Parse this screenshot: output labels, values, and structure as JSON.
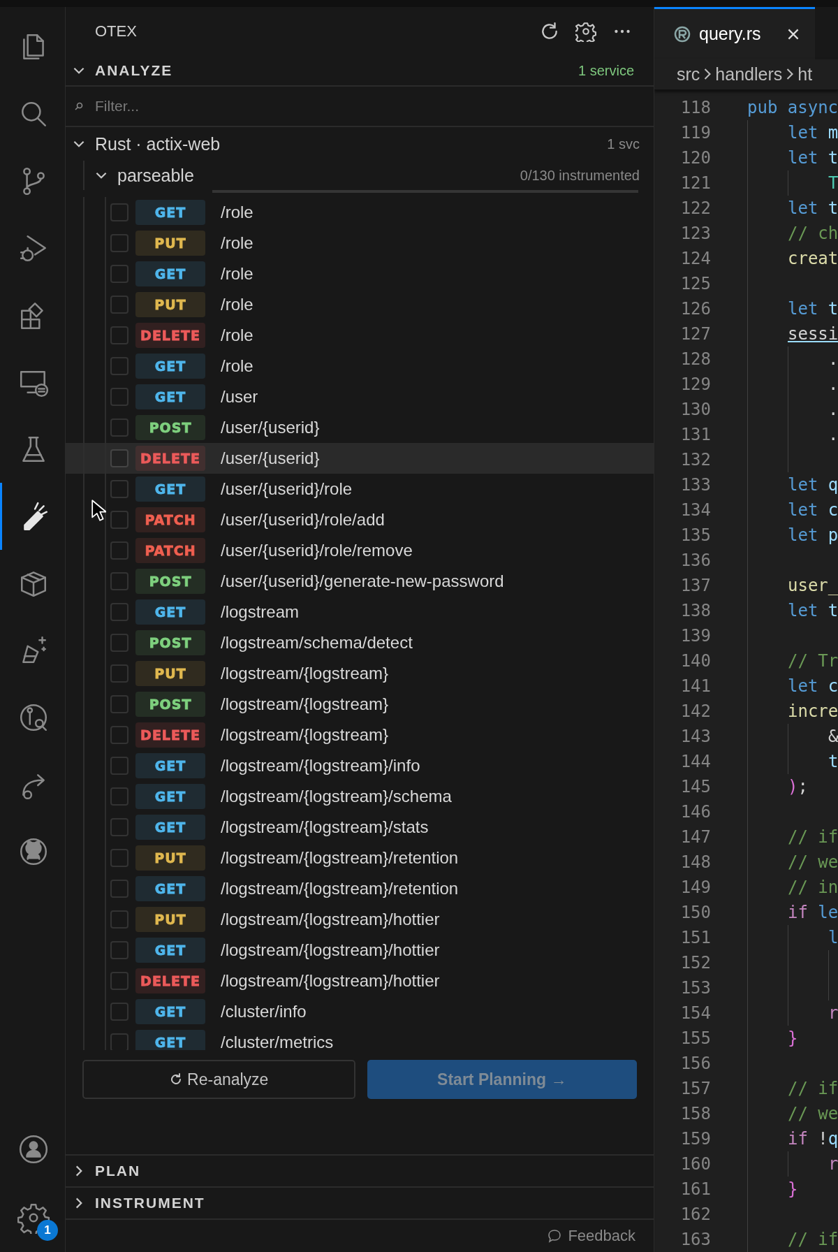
{
  "activity_bar": {
    "items": [
      {
        "kind": "files",
        "selected": false
      },
      {
        "kind": "search",
        "selected": false
      },
      {
        "kind": "branch",
        "selected": false
      },
      {
        "kind": "debug",
        "selected": false
      },
      {
        "kind": "extensions",
        "selected": false
      },
      {
        "kind": "remote",
        "selected": false
      },
      {
        "kind": "flask",
        "selected": false
      },
      {
        "kind": "probe",
        "selected": true
      },
      {
        "kind": "package",
        "selected": false
      },
      {
        "kind": "sparkle-flask",
        "selected": false
      },
      {
        "kind": "graph-search",
        "selected": false
      },
      {
        "kind": "share",
        "selected": false
      },
      {
        "kind": "cat",
        "selected": false
      }
    ],
    "account": {
      "kind": "account"
    },
    "settings": {
      "kind": "settings",
      "badge": "1"
    }
  },
  "sidebar": {
    "title": "OTEX",
    "sections": [
      {
        "title": "ANALYZE",
        "expanded": true,
        "badge": "1 service"
      },
      {
        "title": "PLAN",
        "expanded": false
      },
      {
        "title": "INSTRUMENT",
        "expanded": false
      }
    ],
    "filter": {
      "placeholder": "Filter..."
    },
    "tree": [
      {
        "label": "Rust · actix-web",
        "count": "1 svc",
        "expanded": true,
        "children": [
          {
            "label": "parseable",
            "count": "0/130 instrumented",
            "expanded": true,
            "children": [
              {
                "method": "GET",
                "color": "#4fb6ec",
                "path": "/role",
                "checked": false,
                "hovered": false
              },
              {
                "method": "PUT",
                "color": "#e0b84f",
                "path": "/role",
                "checked": false,
                "hovered": false
              },
              {
                "method": "GET",
                "color": "#4fb6ec",
                "path": "/role",
                "checked": false,
                "hovered": false
              },
              {
                "method": "PUT",
                "color": "#e0b84f",
                "path": "/role",
                "checked": false,
                "hovered": false
              },
              {
                "method": "DELETE",
                "color": "#ec5a5a",
                "path": "/role",
                "checked": false,
                "hovered": false
              },
              {
                "method": "GET",
                "color": "#4fb6ec",
                "path": "/role",
                "checked": false,
                "hovered": false
              },
              {
                "method": "GET",
                "color": "#4fb6ec",
                "path": "/user",
                "checked": false,
                "hovered": false
              },
              {
                "method": "POST",
                "color": "#7ed07e",
                "path": "/user/{userid}",
                "checked": false,
                "hovered": false
              },
              {
                "method": "DELETE",
                "color": "#ec5a5a",
                "path": "/user/{userid}",
                "checked": false,
                "hovered": true
              },
              {
                "method": "GET",
                "color": "#4fb6ec",
                "path": "/user/{userid}/role",
                "checked": false,
                "hovered": false
              },
              {
                "method": "PATCH",
                "color": "#f05f50",
                "path": "/user/{userid}/role/add",
                "checked": false,
                "hovered": false
              },
              {
                "method": "PATCH",
                "color": "#f05f50",
                "path": "/user/{userid}/role/remove",
                "checked": false,
                "hovered": false
              },
              {
                "method": "POST",
                "color": "#7ed07e",
                "path": "/user/{userid}/generate-new-password",
                "checked": false,
                "hovered": false
              },
              {
                "method": "GET",
                "color": "#4fb6ec",
                "path": "/logstream",
                "checked": false,
                "hovered": false
              },
              {
                "method": "POST",
                "color": "#7ed07e",
                "path": "/logstream/schema/detect",
                "checked": false,
                "hovered": false
              },
              {
                "method": "PUT",
                "color": "#e0b84f",
                "path": "/logstream/{logstream}",
                "checked": false,
                "hovered": false
              },
              {
                "method": "POST",
                "color": "#7ed07e",
                "path": "/logstream/{logstream}",
                "checked": false,
                "hovered": false
              },
              {
                "method": "DELETE",
                "color": "#ec5a5a",
                "path": "/logstream/{logstream}",
                "checked": false,
                "hovered": false
              },
              {
                "method": "GET",
                "color": "#4fb6ec",
                "path": "/logstream/{logstream}/info",
                "checked": false,
                "hovered": false
              },
              {
                "method": "GET",
                "color": "#4fb6ec",
                "path": "/logstream/{logstream}/schema",
                "checked": false,
                "hovered": false
              },
              {
                "method": "GET",
                "color": "#4fb6ec",
                "path": "/logstream/{logstream}/stats",
                "checked": false,
                "hovered": false
              },
              {
                "method": "PUT",
                "color": "#e0b84f",
                "path": "/logstream/{logstream}/retention",
                "checked": false,
                "hovered": false
              },
              {
                "method": "GET",
                "color": "#4fb6ec",
                "path": "/logstream/{logstream}/retention",
                "checked": false,
                "hovered": false
              },
              {
                "method": "PUT",
                "color": "#e0b84f",
                "path": "/logstream/{logstream}/hottier",
                "checked": false,
                "hovered": false
              },
              {
                "method": "GET",
                "color": "#4fb6ec",
                "path": "/logstream/{logstream}/hottier",
                "checked": false,
                "hovered": false
              },
              {
                "method": "DELETE",
                "color": "#ec5a5a",
                "path": "/logstream/{logstream}/hottier",
                "checked": false,
                "hovered": false
              },
              {
                "method": "GET",
                "color": "#4fb6ec",
                "path": "/cluster/info",
                "checked": false,
                "hovered": false
              },
              {
                "method": "GET",
                "color": "#4fb6ec",
                "path": "/cluster/metrics",
                "checked": false,
                "hovered": false
              }
            ]
          }
        ]
      }
    ],
    "buttons": [
      {
        "label": "Re-analyze",
        "kind": "secondary",
        "disabled": false
      },
      {
        "label": "Start Planning →",
        "kind": "primary",
        "disabled": true
      }
    ],
    "feedback": "Feedback"
  },
  "editor": {
    "tabs": [
      {
        "label": "query.rs",
        "selected": true
      }
    ],
    "breadcrumbs": [
      "src",
      "handlers",
      "ht"
    ],
    "lines": [
      {
        "n": "118",
        "tokens": [
          {
            "text": "pub async",
            "kind": "keyword"
          }
        ],
        "children": [
          {
            "n": "119",
            "tokens": [
              {
                "text": "let ",
                "kind": "keyword"
              },
              {
                "text": "m",
                "kind": "variable"
              }
            ]
          },
          {
            "n": "120",
            "tokens": [
              {
                "text": "let ",
                "kind": "keyword"
              },
              {
                "text": "t",
                "kind": "variable"
              }
            ],
            "children": [
              {
                "n": "121",
                "tokens": [
                  {
                    "text": "T",
                    "kind": "type"
                  }
                ]
              }
            ]
          },
          {
            "n": "122",
            "tokens": [
              {
                "text": "let ",
                "kind": "keyword"
              },
              {
                "text": "t",
                "kind": "variable"
              }
            ]
          },
          {
            "n": "123",
            "tokens": [
              {
                "text": "// ch",
                "kind": "comment"
              }
            ]
          },
          {
            "n": "124",
            "tokens": [
              {
                "text": "creat",
                "kind": "function"
              }
            ]
          },
          {
            "n": "125"
          },
          {
            "n": "126",
            "tokens": [
              {
                "text": "let ",
                "kind": "keyword"
              },
              {
                "text": "t",
                "kind": "variable"
              }
            ]
          },
          {
            "n": "127",
            "tokens": [
              {
                "text": "sessi",
                "kind": "link"
              }
            ],
            "children": [
              {
                "n": "128",
                "tokens": [
                  {
                    "text": ".",
                    "kind": "punct"
                  }
                ]
              },
              {
                "n": "129",
                "tokens": [
                  {
                    "text": ".",
                    "kind": "punct"
                  }
                ]
              },
              {
                "n": "130",
                "tokens": [
                  {
                    "text": ".",
                    "kind": "punct"
                  }
                ]
              },
              {
                "n": "131",
                "tokens": [
                  {
                    "text": ".",
                    "kind": "punct"
                  }
                ]
              },
              {
                "n": "132"
              }
            ]
          },
          {
            "n": "133",
            "tokens": [
              {
                "text": "let ",
                "kind": "keyword"
              },
              {
                "text": "q",
                "kind": "variable"
              }
            ]
          },
          {
            "n": "134",
            "tokens": [
              {
                "text": "let ",
                "kind": "keyword"
              },
              {
                "text": "c",
                "kind": "variable"
              }
            ]
          },
          {
            "n": "135",
            "tokens": [
              {
                "text": "let ",
                "kind": "keyword"
              },
              {
                "text": "p",
                "kind": "variable"
              }
            ]
          },
          {
            "n": "136"
          },
          {
            "n": "137",
            "tokens": [
              {
                "text": "user_",
                "kind": "function"
              }
            ]
          },
          {
            "n": "138",
            "tokens": [
              {
                "text": "let ",
                "kind": "keyword"
              },
              {
                "text": "t",
                "kind": "variable"
              }
            ]
          },
          {
            "n": "139"
          },
          {
            "n": "140",
            "tokens": [
              {
                "text": "// Tr",
                "kind": "comment"
              }
            ]
          },
          {
            "n": "141",
            "tokens": [
              {
                "text": "let ",
                "kind": "keyword"
              },
              {
                "text": "c",
                "kind": "variable"
              }
            ]
          },
          {
            "n": "142",
            "tokens": [
              {
                "text": "incre",
                "kind": "function"
              }
            ],
            "children": [
              {
                "n": "143",
                "tokens": [
                  {
                    "text": "&",
                    "kind": "punct"
                  }
                ]
              },
              {
                "n": "144",
                "tokens": [
                  {
                    "text": "t",
                    "kind": "variable"
                  }
                ]
              }
            ]
          },
          {
            "n": "145",
            "tokens": [
              {
                "text": ")",
                "kind": "bracket"
              },
              {
                "text": ";",
                "kind": "punct"
              }
            ]
          },
          {
            "n": "146"
          },
          {
            "n": "147",
            "tokens": [
              {
                "text": "// if",
                "kind": "comment"
              }
            ]
          },
          {
            "n": "148",
            "tokens": [
              {
                "text": "// we",
                "kind": "comment"
              }
            ]
          },
          {
            "n": "149",
            "tokens": [
              {
                "text": "// in",
                "kind": "comment"
              }
            ]
          },
          {
            "n": "150",
            "tokens": [
              {
                "text": "if ",
                "kind": "control"
              },
              {
                "text": "le",
                "kind": "keyword"
              }
            ],
            "children": [
              {
                "n": "151",
                "tokens": [
                  {
                    "text": "l",
                    "kind": "keyword"
                  }
                ],
                "children": [
                  {
                    "n": "152"
                  },
                  {
                    "n": "153"
                  }
                ]
              },
              {
                "n": "154",
                "tokens": [
                  {
                    "text": "r",
                    "kind": "control"
                  }
                ]
              }
            ]
          },
          {
            "n": "155",
            "tokens": [
              {
                "text": "}",
                "kind": "bracket"
              }
            ]
          },
          {
            "n": "156"
          },
          {
            "n": "157",
            "tokens": [
              {
                "text": "// if",
                "kind": "comment"
              }
            ]
          },
          {
            "n": "158",
            "tokens": [
              {
                "text": "// we",
                "kind": "comment"
              }
            ]
          },
          {
            "n": "159",
            "tokens": [
              {
                "text": "if ",
                "kind": "control"
              },
              {
                "text": "!",
                "kind": "punct"
              },
              {
                "text": "q",
                "kind": "variable"
              }
            ],
            "children": [
              {
                "n": "160",
                "tokens": [
                  {
                    "text": "r",
                    "kind": "control"
                  }
                ]
              }
            ]
          },
          {
            "n": "161",
            "tokens": [
              {
                "text": "}",
                "kind": "bracket"
              }
            ]
          },
          {
            "n": "162"
          },
          {
            "n": "163",
            "tokens": [
              {
                "text": "// if",
                "kind": "comment"
              }
            ]
          }
        ]
      }
    ]
  }
}
